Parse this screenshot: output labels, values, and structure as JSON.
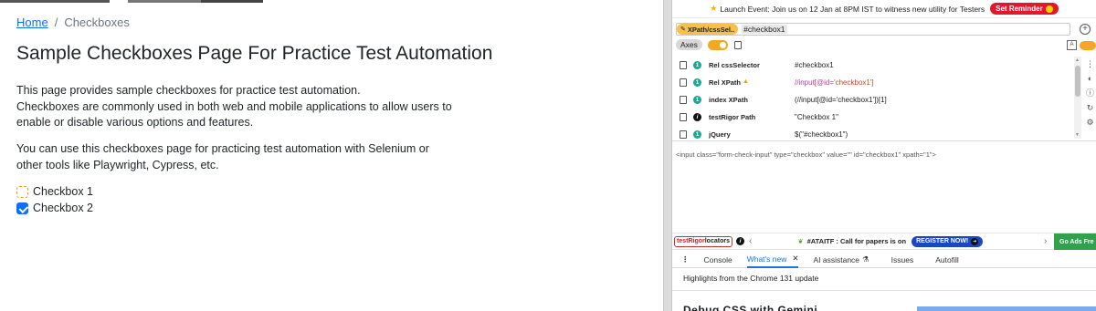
{
  "page": {
    "breadcrumb": {
      "home": "Home",
      "separator": "/",
      "current": "Checkboxes"
    },
    "title": "Sample Checkboxes Page For Practice Test Automation",
    "para1_line1": "This page provides sample checkboxes for practice test automation.",
    "para1_line2": "Checkboxes are commonly used in both web and mobile applications to allow users to",
    "para1_line3": "enable or disable various options and features.",
    "para2_line1": "You can use this checkboxes page for practicing test automation with Selenium or",
    "para2_line2": "other tools like Playwright, Cypress, etc.",
    "checkboxes": [
      {
        "label": "Checkbox 1",
        "checked": false
      },
      {
        "label": "Checkbox 2",
        "checked": true
      }
    ]
  },
  "devtools": {
    "banner": {
      "text": "Launch Event: Join us on 12 Jan at 8PM IST to witness new utility for Testers",
      "button": "Set Reminder"
    },
    "selector_bar": {
      "mode": "XPath/cssSel..",
      "value": "#checkbox1"
    },
    "axes_label": "Axes",
    "locators": [
      {
        "num": "1",
        "name": "Rel cssSelector",
        "value": "#checkbox1"
      },
      {
        "num": "1",
        "name": "Rel XPath",
        "value": "//input[@id='checkbox1']"
      },
      {
        "num": "1",
        "name": "index XPath",
        "value": "(//input[@id='checkbox1'])[1]"
      },
      {
        "num": "i",
        "name": "testRigor Path",
        "value": "\"Checkbox 1\""
      },
      {
        "num": "1",
        "name": "jQuery",
        "value": "$(\"#checkbox1\")"
      }
    ],
    "html_snippet": "<input class=\"form-check-input\" type=\"checkbox\" value=\"\" id=\"checkbox1\" xpath=\"1\">",
    "bottom": {
      "testrigor_red": "testRigor",
      "testrigor_rest": " locators",
      "ad_text": "#ATAITF : Call for papers is on",
      "register": "REGISTER NOW!",
      "go_ads": "Go Ads Fre"
    },
    "tabs": [
      {
        "label": "Console"
      },
      {
        "label": "What's new"
      },
      {
        "label": "AI assistance"
      },
      {
        "label": "Issues"
      },
      {
        "label": "Autofill"
      }
    ],
    "highlights": "Highlights from the Chrome 131 update",
    "cut_title": "Debug CSS with Gemini"
  }
}
